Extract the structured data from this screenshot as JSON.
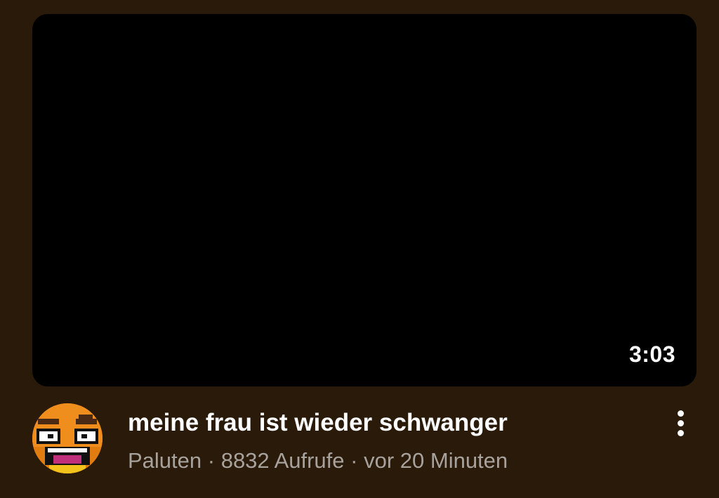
{
  "video": {
    "duration": "3:03",
    "title": "meine frau ist wieder schwanger",
    "channel": "Paluten",
    "separator": " · ",
    "views": "8832 Aufrufe",
    "age": "vor 20 Minuten"
  },
  "icons": {
    "menu": "more-vert-icon",
    "avatar": "channel-avatar"
  },
  "colors": {
    "background": "#2a1a0a",
    "thumbnail": "#000000",
    "title": "#ffffff",
    "meta": "#a8a29c",
    "avatar_face": "#ef8e1c"
  }
}
